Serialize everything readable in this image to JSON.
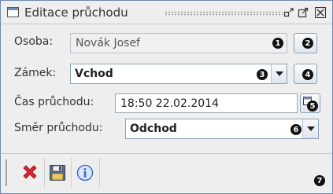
{
  "window": {
    "title": "Editace průchodu",
    "icons": [
      "window-icon",
      "restore-icon",
      "maximize-icon",
      "close-icon"
    ]
  },
  "form": {
    "person": {
      "label": "Osoba:",
      "value": "Novák Josef",
      "badge": "1",
      "button_badge": "2"
    },
    "lock": {
      "label": "Zámek:",
      "value": "Vchod",
      "badge": "3",
      "button_badge": "4"
    },
    "time": {
      "label": "Čas průchodu:",
      "value": "18:50 22.02.2014",
      "button_badge": "5"
    },
    "direction": {
      "label": "Směr průchodu:",
      "value": "Odchod",
      "badge": "6"
    }
  },
  "toolbar": {
    "badge": "7",
    "buttons": [
      "cancel-icon",
      "save-icon",
      "info-icon"
    ]
  },
  "colors": {
    "border": "#6d8cae",
    "background": "#eeeeee",
    "cancel": "#d9232e",
    "info": "#3a73c8"
  }
}
